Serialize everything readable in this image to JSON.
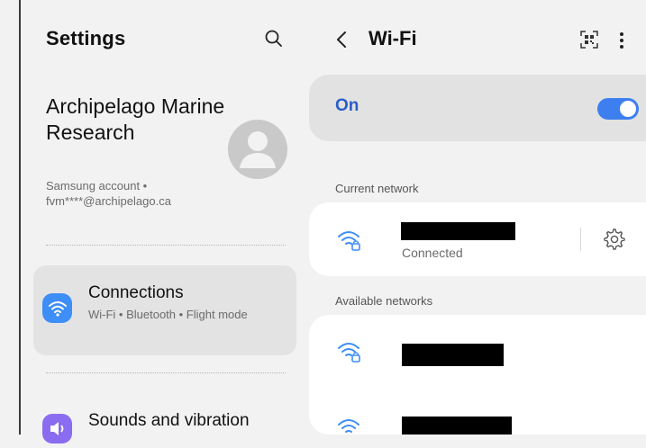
{
  "left": {
    "title": "Settings",
    "account": {
      "name": "Archipelago Marine Research",
      "subtitle": "Samsung account •\nfvm****@archipelago.ca"
    },
    "items": [
      {
        "id": "connections",
        "title": "Connections",
        "subtitle": "Wi-Fi • Bluetooth • Flight mode",
        "icon": "wifi-icon",
        "color": "#3e8ef7",
        "selected": true
      },
      {
        "id": "sounds",
        "title": "Sounds and vibration",
        "icon": "speaker-icon",
        "color": "#8a6cf0",
        "selected": false
      }
    ]
  },
  "right": {
    "title": "Wi-Fi",
    "toggle": {
      "label": "On",
      "state": true,
      "color": "#3e7ff0"
    },
    "current_section_label": "Current network",
    "current_network": {
      "ssid": "",
      "status": "Connected",
      "ssid_redacted": true
    },
    "available_section_label": "Available networks",
    "available_networks": [
      {
        "ssid": "",
        "ssid_redacted": true
      },
      {
        "ssid": "",
        "ssid_redacted": true
      }
    ]
  },
  "icons": [
    "search-icon",
    "back-arrow-icon",
    "qr-scan-icon",
    "more-options-icon",
    "settings-gear-icon",
    "wifi-lock-icon",
    "person-avatar-icon"
  ]
}
